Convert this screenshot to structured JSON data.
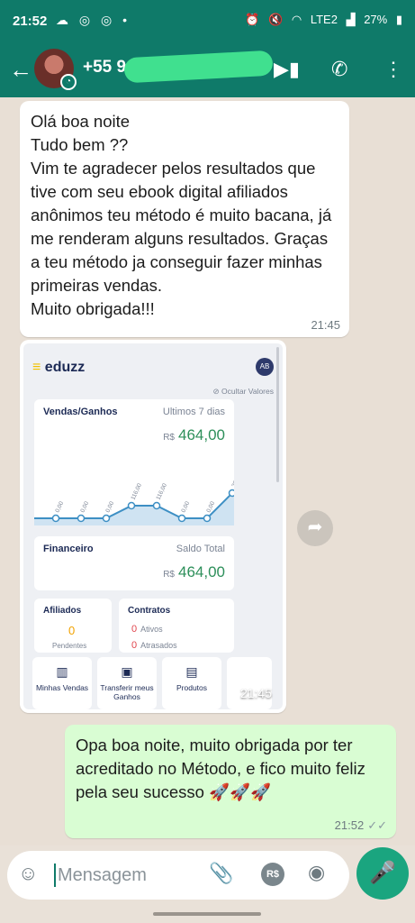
{
  "status_bar": {
    "time": "21:52",
    "battery": "27%",
    "network": "LTE2"
  },
  "header": {
    "contact": "+55 9",
    "accent": "#0f7a69"
  },
  "messages": {
    "incoming_text": "Olá boa noite\nTudo bem ??\nVim te agradecer pelos resultados que tive com seu ebook digital afiliados anônimos teu método é muito bacana, já me renderam alguns resultados. Graças a teu método ja conseguir fazer minhas primeiras vendas.\nMuito obrigada!!!",
    "incoming_time": "21:45",
    "image_time": "21:45",
    "outgoing_text": "Opa boa noite, muito obrigada por ter acreditado no Método, e fico muito feliz pela seu sucesso 🚀🚀🚀",
    "outgoing_time": "21:52"
  },
  "screenshot": {
    "logo": "eduzz",
    "avatar_initials": "AB",
    "hide_values": "Ocultar Valores",
    "sales_label": "Vendas/Ganhos",
    "period": "Ultimos 7 dias",
    "currency": "R$",
    "sales_amount": "464,00",
    "finance_label": "Financeiro",
    "balance_label": "Saldo Total",
    "finance_amount": "464,00",
    "affiliates_label": "Afiliados",
    "affiliates_value": "0",
    "affiliates_sub": "Pendentes",
    "contracts_label": "Contratos",
    "contracts_active_value": "0",
    "contracts_active": "Ativos",
    "contracts_late_value": "0",
    "contracts_late": "Atrasados",
    "tiles": [
      "Minhas Vendas",
      "Transferir meus Ganhos",
      "Produtos"
    ]
  },
  "chart_data": {
    "type": "line",
    "labels": [
      "0,00",
      "0,00",
      "0,00",
      "116,00",
      "116,00",
      "0,00",
      "0,00",
      "232,00"
    ],
    "values": [
      0,
      0,
      0,
      116,
      116,
      0,
      0,
      232
    ]
  },
  "input": {
    "placeholder": "Mensagem"
  }
}
